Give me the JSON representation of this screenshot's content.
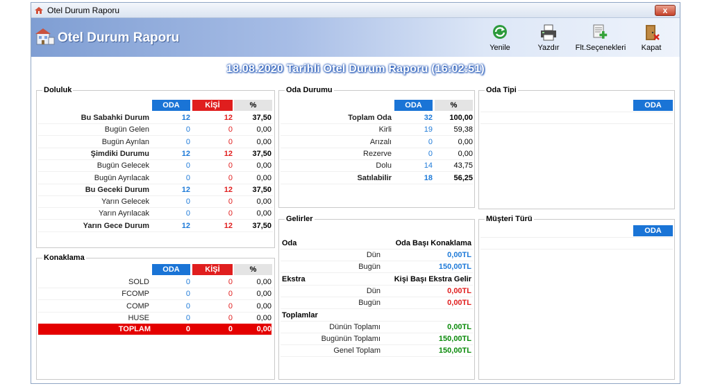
{
  "window": {
    "title": "Otel Durum Raporu",
    "close_label": "x"
  },
  "header": {
    "title": "Otel Durum Raporu"
  },
  "toolbar": {
    "refresh": "Yenile",
    "print": "Yazdır",
    "filter": "Flt.Seçenekleri",
    "close": "Kapat"
  },
  "report_title": "18.08.2020 Tarihli Otel Durum Raporu (16:02:51)",
  "doluluk": {
    "title": "Doluluk",
    "headers": {
      "oda": "ODA",
      "kisi": "KİŞİ",
      "pct": "%"
    },
    "rows": [
      {
        "label": "Bu Sabahki Durum",
        "oda": "12",
        "kisi": "12",
        "pct": "37,50"
      },
      {
        "label": "Bugün Gelen",
        "oda": "0",
        "kisi": "0",
        "pct": "0,00"
      },
      {
        "label": "Bugün Ayrılan",
        "oda": "0",
        "kisi": "0",
        "pct": "0,00"
      },
      {
        "label": "Şimdiki Durumu",
        "oda": "12",
        "kisi": "12",
        "pct": "37,50"
      },
      {
        "label": "Bugün Gelecek",
        "oda": "0",
        "kisi": "0",
        "pct": "0,00"
      },
      {
        "label": "Bugün Ayrılacak",
        "oda": "0",
        "kisi": "0",
        "pct": "0,00"
      },
      {
        "label": "Bu Geceki Durum",
        "oda": "12",
        "kisi": "12",
        "pct": "37,50"
      },
      {
        "label": "Yarın Gelecek",
        "oda": "0",
        "kisi": "0",
        "pct": "0,00"
      },
      {
        "label": "Yarın Ayrılacak",
        "oda": "0",
        "kisi": "0",
        "pct": "0,00"
      },
      {
        "label": "Yarın Gece Durum",
        "oda": "12",
        "kisi": "12",
        "pct": "37,50"
      }
    ]
  },
  "konaklama": {
    "title": "Konaklama",
    "headers": {
      "oda": "ODA",
      "kisi": "KİŞİ",
      "pct": "%"
    },
    "rows": [
      {
        "label": "SOLD",
        "oda": "0",
        "kisi": "0",
        "pct": "0,00"
      },
      {
        "label": "FCOMP",
        "oda": "0",
        "kisi": "0",
        "pct": "0,00"
      },
      {
        "label": "COMP",
        "oda": "0",
        "kisi": "0",
        "pct": "0,00"
      },
      {
        "label": "HUSE",
        "oda": "0",
        "kisi": "0",
        "pct": "0,00"
      }
    ],
    "total": {
      "label": "TOPLAM",
      "oda": "0",
      "kisi": "0",
      "pct": "0,00"
    }
  },
  "oda_durumu": {
    "title": "Oda Durumu",
    "headers": {
      "oda": "ODA",
      "pct": "%"
    },
    "rows": [
      {
        "label": "Toplam Oda",
        "oda": "32",
        "pct": "100,00"
      },
      {
        "label": "Kirli",
        "oda": "19",
        "pct": "59,38"
      },
      {
        "label": "Arızalı",
        "oda": "0",
        "pct": "0,00"
      },
      {
        "label": "Rezerve",
        "oda": "0",
        "pct": "0,00"
      },
      {
        "label": "Dolu",
        "oda": "14",
        "pct": "43,75"
      },
      {
        "label": "Satılabilir",
        "oda": "18",
        "pct": "56,25"
      }
    ]
  },
  "gelirler": {
    "title": "Gelirler",
    "oda": {
      "label": "Oda",
      "col": "Oda Başı Konaklama",
      "dun_label": "Dün",
      "dun": "0,00TL",
      "bugun_label": "Bugün",
      "bugun": "150,00TL"
    },
    "ekstra": {
      "label": "Ekstra",
      "col": "Kişi Başı Ekstra Gelir",
      "dun_label": "Dün",
      "dun": "0,00TL",
      "bugun_label": "Bugün",
      "bugun": "0,00TL"
    },
    "toplamlar": {
      "label": "Toplamlar",
      "dun_label": "Dünün Toplamı",
      "dun": "0,00TL",
      "bugun_label": "Bugünün Toplamı",
      "bugun": "150,00TL",
      "genel_label": "Genel Toplam",
      "genel": "150,00TL"
    }
  },
  "oda_tipi": {
    "title": "Oda Tipi",
    "header": "ODA"
  },
  "musteri_turu": {
    "title": "Müşteri Türü",
    "header": "ODA"
  }
}
